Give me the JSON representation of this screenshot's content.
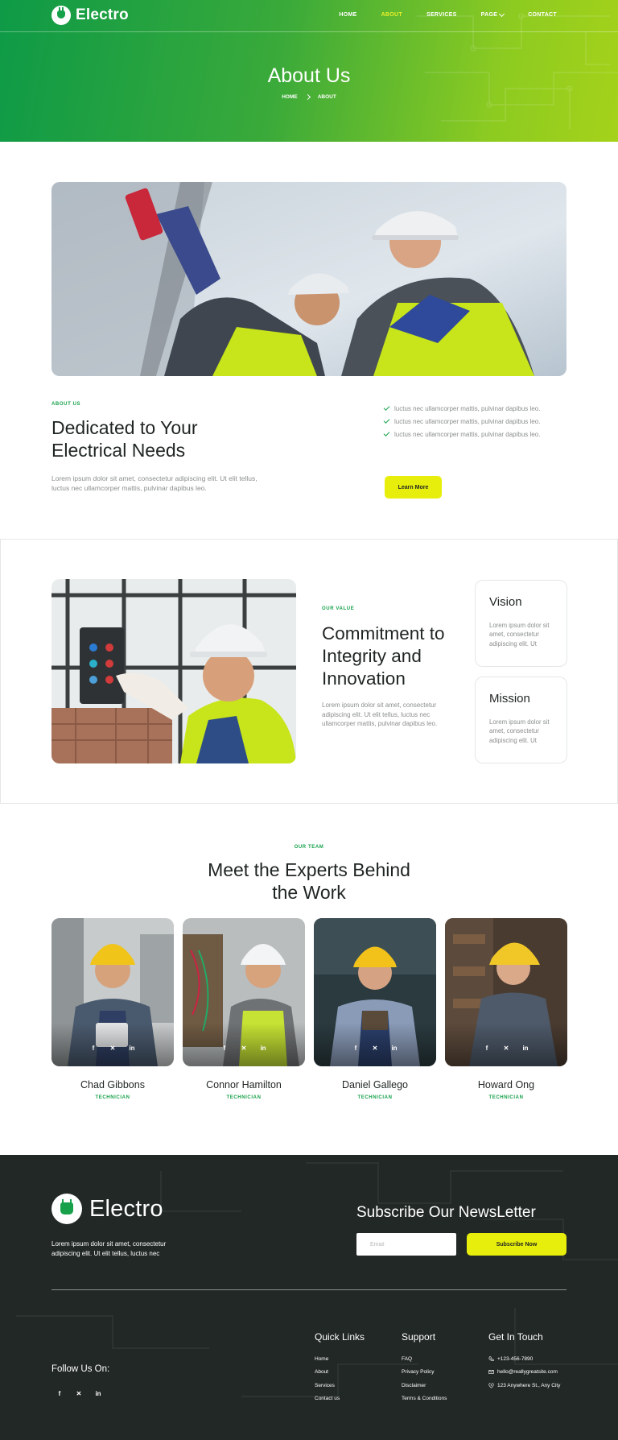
{
  "brand": {
    "name": "Electro",
    "green": "#16a14a",
    "yellow": "#e8ee0c",
    "dark": "#222826"
  },
  "nav": {
    "items": [
      {
        "label": "HOME"
      },
      {
        "label": "ABOUT"
      },
      {
        "label": "SERVICES"
      },
      {
        "label": "PAGE"
      },
      {
        "label": "CONTACT"
      }
    ],
    "active": "ABOUT"
  },
  "hero": {
    "title": "About Us",
    "breadcrumb": [
      "HOME",
      "ABOUT"
    ]
  },
  "about": {
    "eyebrow": "ABOUT US",
    "title_line1": "Dedicated to Your",
    "title_line2": "Electrical Needs",
    "text": "Lorem ipsum dolor sit amet, consectetur adipiscing elit. Ut elit tellus, luctus nec ullamcorper mattis, pulvinar dapibus leo.",
    "checks": [
      "luctus nec ullamcorper mattis, pulvinar dapibus leo.",
      "luctus nec ullamcorper mattis, pulvinar dapibus leo.",
      "luctus nec ullamcorper mattis, pulvinar dapibus leo."
    ],
    "button": "Learn More"
  },
  "values": {
    "eyebrow": "OUR VALUE",
    "title_line1": "Commitment to",
    "title_line2": "Integrity and",
    "title_line3": "Innovation",
    "text": "Lorem ipsum dolor sit amet, consectetur adipiscing elit. Ut elit tellus, luctus nec ullamcorper mattis, pulvinar dapibus leo.",
    "cards": [
      {
        "title": "Vision",
        "text": "Lorem ipsum dolor sit amet, consectetur adipiscing elit. Ut"
      },
      {
        "title": "Mission",
        "text": "Lorem ipsum dolor sit amet, consectetur adipiscing elit. Ut"
      }
    ]
  },
  "team": {
    "eyebrow": "OUR TEAM",
    "title_line1": "Meet the Experts Behind",
    "title_line2": "the Work",
    "members": [
      {
        "name": "Chad Gibbons",
        "role": "TECHNICIAN"
      },
      {
        "name": "Connor Hamilton",
        "role": "TECHNICIAN"
      },
      {
        "name": "Daniel Gallego",
        "role": "TECHNICIAN"
      },
      {
        "name": "Howard Ong",
        "role": "TECHNICIAN"
      }
    ],
    "social_icons": [
      "facebook-icon",
      "x-icon",
      "linkedin-icon"
    ]
  },
  "footer": {
    "brand": "Electro",
    "description": "Lorem ipsum dolor sit amet, consectetur adipiscing elit. Ut elit tellus, luctus nec",
    "newsletter_title": "Subscribe Our NewsLetter",
    "email_placeholder": "Email",
    "subscribe_button": "Subscribe Now",
    "follow_label": "Follow Us On:",
    "quick_links": {
      "title": "Quick Links",
      "items": [
        "Home",
        "About",
        "Services",
        "Contact us"
      ]
    },
    "support": {
      "title": "Support",
      "items": [
        "FAQ",
        "Privacy Policy",
        "Disclaimer",
        "Terms & Conditions"
      ]
    },
    "contact": {
      "title": "Get In Touch",
      "phone": "+123-456-7890",
      "email": "hello@reallygreatsite.com",
      "address": "123 Anywhere St., Any City"
    }
  }
}
